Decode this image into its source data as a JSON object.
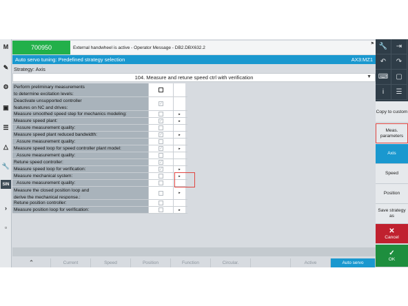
{
  "header": {
    "alarm_number": "700950",
    "alarm_text": "External handwheel is active - Operator Message - DB2.DBX632.2"
  },
  "title_bar": {
    "title": "Auto servo tuning: Predefined strategy selection",
    "axis": "AX3:MZ1"
  },
  "strategy": {
    "label": "Strategy: Axis",
    "selected": "104. Measure and retune speed ctrl with verification"
  },
  "rows": [
    {
      "label_lines": [
        "Perform preliminary measurements",
        "to determine excitation levels:"
      ],
      "checked": false,
      "active": true,
      "has_button": false
    },
    {
      "label_lines": [
        "Deactivate unsupported controller",
        "features on NC and drives:"
      ],
      "checked": true,
      "active": false,
      "has_button": false
    },
    {
      "label_lines": [
        "Measure smoothed speed step for mechanics modeling:"
      ],
      "checked": false,
      "active": false,
      "has_button": true
    },
    {
      "label_lines": [
        "Measure speed plant:"
      ],
      "checked": true,
      "active": false,
      "has_button": true
    },
    {
      "label_lines": [
        "Assure measurement quality:"
      ],
      "checked": false,
      "active": false,
      "has_button": false,
      "indent": true
    },
    {
      "label_lines": [
        "Measure speed plant reduced bandwidth:"
      ],
      "checked": true,
      "active": false,
      "has_button": true
    },
    {
      "label_lines": [
        "Assure measurement quality:"
      ],
      "checked": false,
      "active": false,
      "has_button": false,
      "indent": true
    },
    {
      "label_lines": [
        "Measure speed loop for speed controller plant model:"
      ],
      "checked": true,
      "active": false,
      "has_button": true
    },
    {
      "label_lines": [
        "Assure measurement quality:"
      ],
      "checked": false,
      "active": false,
      "has_button": false,
      "indent": true
    },
    {
      "label_lines": [
        "Retune speed controller:"
      ],
      "checked": true,
      "active": false,
      "has_button": false
    },
    {
      "label_lines": [
        "Measure speed loop for verification:"
      ],
      "checked": true,
      "active": false,
      "has_button": true
    },
    {
      "label_lines": [
        "Measure mechanical system:"
      ],
      "checked": false,
      "active": false,
      "has_button": true
    },
    {
      "label_lines": [
        "Assure measurement quality:"
      ],
      "checked": false,
      "active": false,
      "has_button": false,
      "indent": true
    },
    {
      "label_lines": [
        "Measure the closed position loop and",
        "derive the mechanical response.:"
      ],
      "checked": false,
      "active": false,
      "has_button": true
    },
    {
      "label_lines": [
        "Retune position controller:"
      ],
      "checked": false,
      "active": false,
      "has_button": false
    },
    {
      "label_lines": [
        "Measure position loop for verification:"
      ],
      "checked": false,
      "active": false,
      "has_button": true
    }
  ],
  "softkeys_horizontal": [
    "Current",
    "Speed",
    "Position",
    "Function",
    "Circular.",
    "",
    "Active",
    "Auto servo"
  ],
  "softkeys_vertical": {
    "copy": "Copy to custom",
    "meas": "Meas. parameters",
    "axis": "Axis",
    "speed": "Speed",
    "position": "Position",
    "save": "Save strategy as",
    "cancel": "Cancel",
    "ok": "OK"
  },
  "left_strip_icons": [
    "machine-icon",
    "edit-icon",
    "settings-icon",
    "program-icon",
    "list-icon",
    "warning-icon",
    "wrench-icon",
    "sinumerik-icon",
    "arrow-right-icon",
    "panel-icon"
  ],
  "colors": {
    "alarm_green": "#22b04a",
    "title_blue": "#1a98cf",
    "cancel_red": "#c0212f",
    "ok_green": "#1e8e3e",
    "highlight_red": "#e0443f"
  }
}
